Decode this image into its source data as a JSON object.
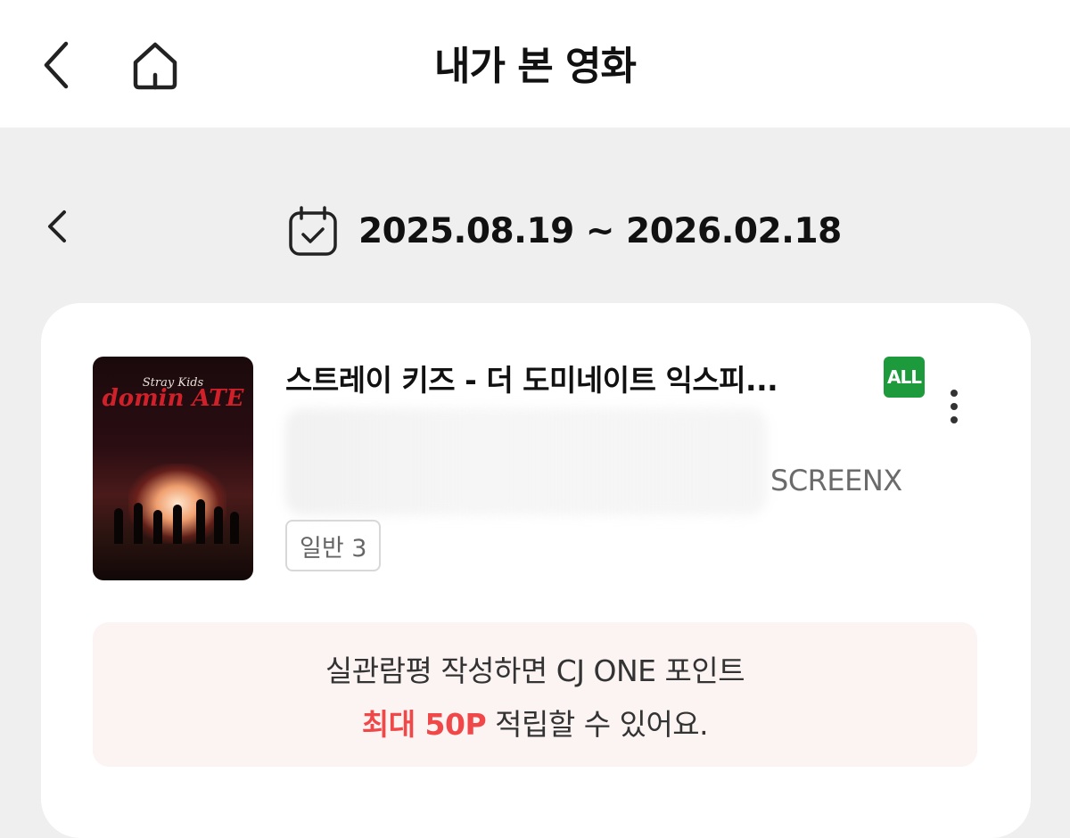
{
  "header": {
    "title": "내가 본 영화",
    "back_icon": "chevron-left-icon",
    "home_icon": "home-icon"
  },
  "period": {
    "range": "2025.08.19 ~ 2026.02.18",
    "calendar_icon": "calendar-check-icon",
    "prev_icon": "chevron-left-icon"
  },
  "movie": {
    "title": "스트레이 키즈 - 더 도미네이트 익스피...",
    "rating": "ALL",
    "format": "SCREENX",
    "seat_type": "일반 3",
    "poster": {
      "brand": "Stray Kids",
      "logo": "domin ATE"
    }
  },
  "promo": {
    "line1": "실관람평 작성하면 CJ ONE 포인트",
    "highlight": "최대 50P",
    "line2_rest": " 적립할 수 있어요."
  },
  "colors": {
    "rating_green": "#1d9a3b",
    "highlight_red": "#f04848",
    "promo_bg": "#fcf3f3"
  }
}
